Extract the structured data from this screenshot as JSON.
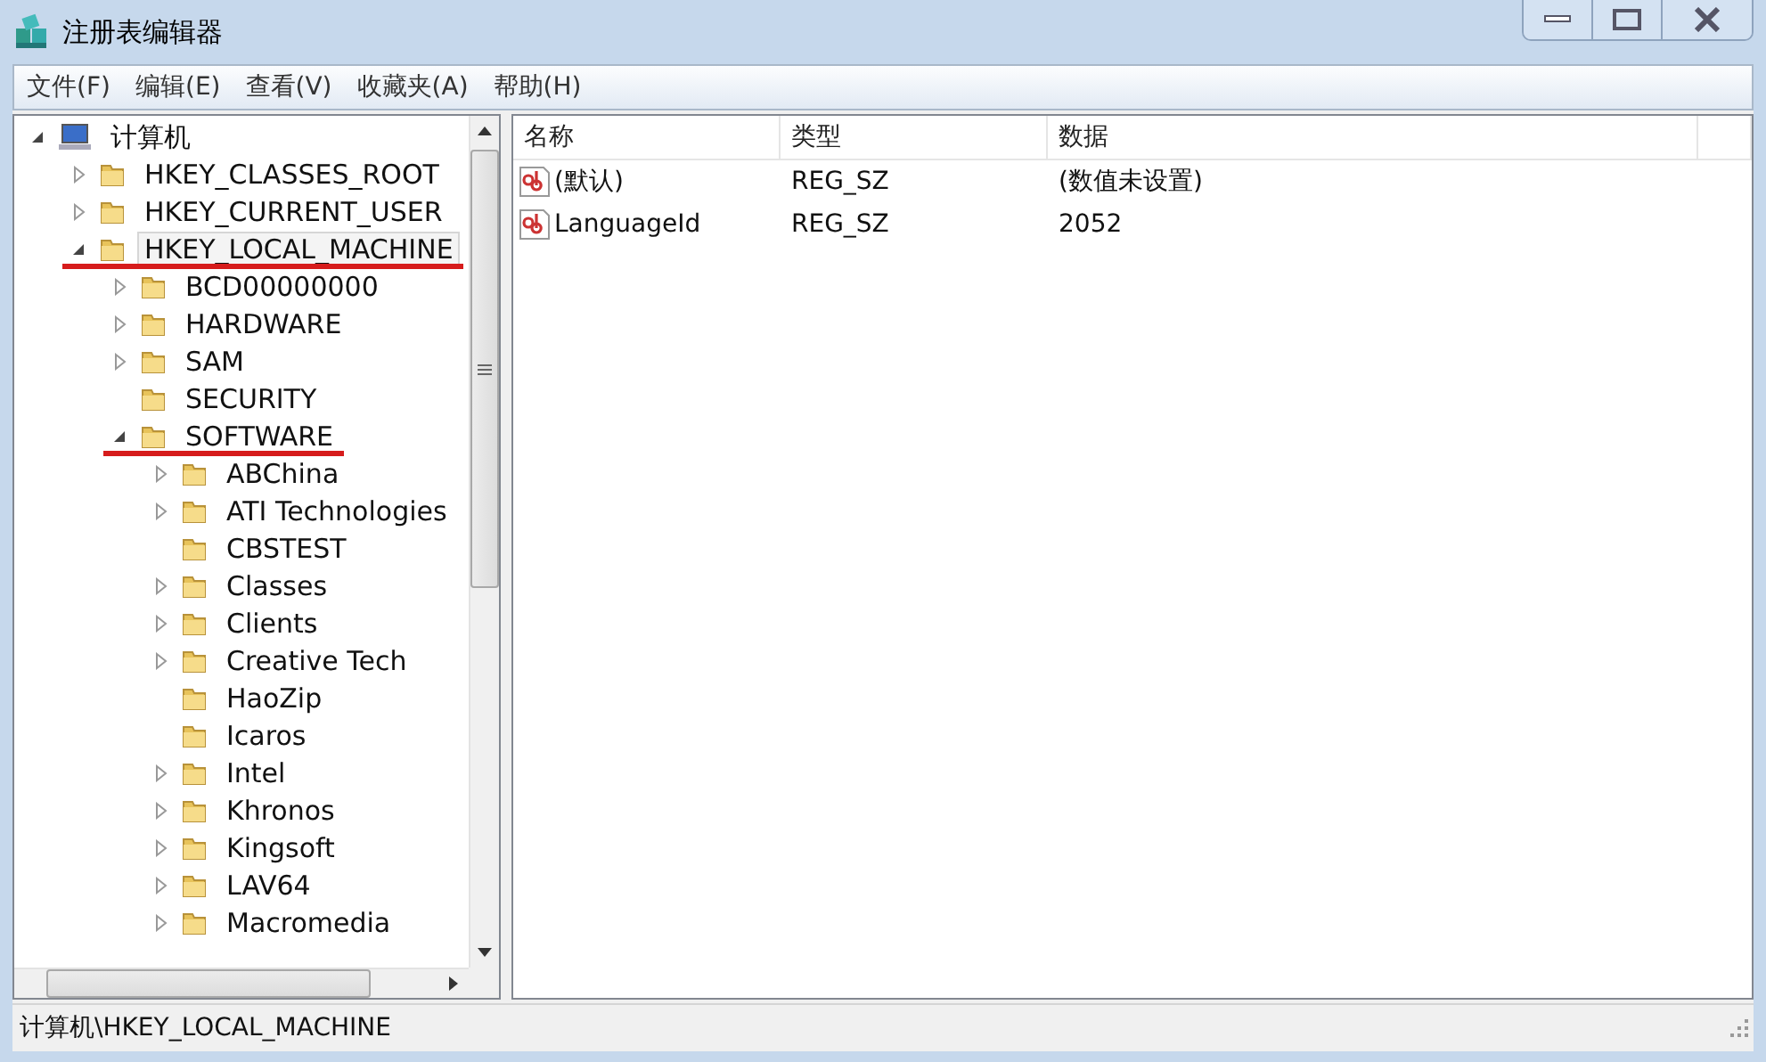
{
  "window": {
    "title": "注册表编辑器"
  },
  "menu": [
    {
      "label": "文件(F)"
    },
    {
      "label": "编辑(E)"
    },
    {
      "label": "查看(V)"
    },
    {
      "label": "收藏夹(A)"
    },
    {
      "label": "帮助(H)"
    }
  ],
  "tree": [
    {
      "label": "计算机",
      "kind": "computer",
      "expanded": true,
      "selected": false,
      "children": [
        {
          "label": "HKEY_CLASSES_ROOT",
          "kind": "folder",
          "expanded": false,
          "selected": false
        },
        {
          "label": "HKEY_CURRENT_USER",
          "kind": "folder",
          "expanded": false,
          "selected": false
        },
        {
          "label": "HKEY_LOCAL_MACHINE",
          "kind": "folder",
          "expanded": true,
          "selected": true,
          "underlined": true,
          "children": [
            {
              "label": "BCD00000000",
              "kind": "folder",
              "expanded": false,
              "selected": false
            },
            {
              "label": "HARDWARE",
              "kind": "folder",
              "expanded": false,
              "selected": false
            },
            {
              "label": "SAM",
              "kind": "folder",
              "expanded": false,
              "selected": false
            },
            {
              "label": "SECURITY",
              "kind": "folder",
              "selected": false
            },
            {
              "label": "SOFTWARE",
              "kind": "folder",
              "expanded": true,
              "selected": false,
              "underlined": true,
              "children": [
                {
                  "label": "ABChina",
                  "kind": "folder",
                  "expanded": false,
                  "selected": false
                },
                {
                  "label": "ATI Technologies",
                  "kind": "folder",
                  "expanded": false,
                  "selected": false
                },
                {
                  "label": "CBSTEST",
                  "kind": "folder",
                  "selected": false
                },
                {
                  "label": "Classes",
                  "kind": "folder",
                  "expanded": false,
                  "selected": false
                },
                {
                  "label": "Clients",
                  "kind": "folder",
                  "expanded": false,
                  "selected": false
                },
                {
                  "label": "Creative Tech",
                  "kind": "folder",
                  "expanded": false,
                  "selected": false
                },
                {
                  "label": "HaoZip",
                  "kind": "folder",
                  "selected": false
                },
                {
                  "label": "Icaros",
                  "kind": "folder",
                  "selected": false
                },
                {
                  "label": "Intel",
                  "kind": "folder",
                  "expanded": false,
                  "selected": false
                },
                {
                  "label": "Khronos",
                  "kind": "folder",
                  "expanded": false,
                  "selected": false
                },
                {
                  "label": "Kingsoft",
                  "kind": "folder",
                  "expanded": false,
                  "selected": false
                },
                {
                  "label": "LAV64",
                  "kind": "folder",
                  "expanded": false,
                  "selected": false
                },
                {
                  "label": "Macromedia",
                  "kind": "folder",
                  "expanded": false,
                  "selected": false
                }
              ]
            }
          ]
        }
      ]
    }
  ],
  "table": {
    "columns": [
      "名称",
      "类型",
      "数据"
    ],
    "rows": [
      {
        "name": "(默认)",
        "type": "REG_SZ",
        "data": "(数值未设置)"
      },
      {
        "name": "LanguageId",
        "type": "REG_SZ",
        "data": "2052"
      }
    ]
  },
  "status_bar": "计算机\\HKEY_LOCAL_MACHINE"
}
